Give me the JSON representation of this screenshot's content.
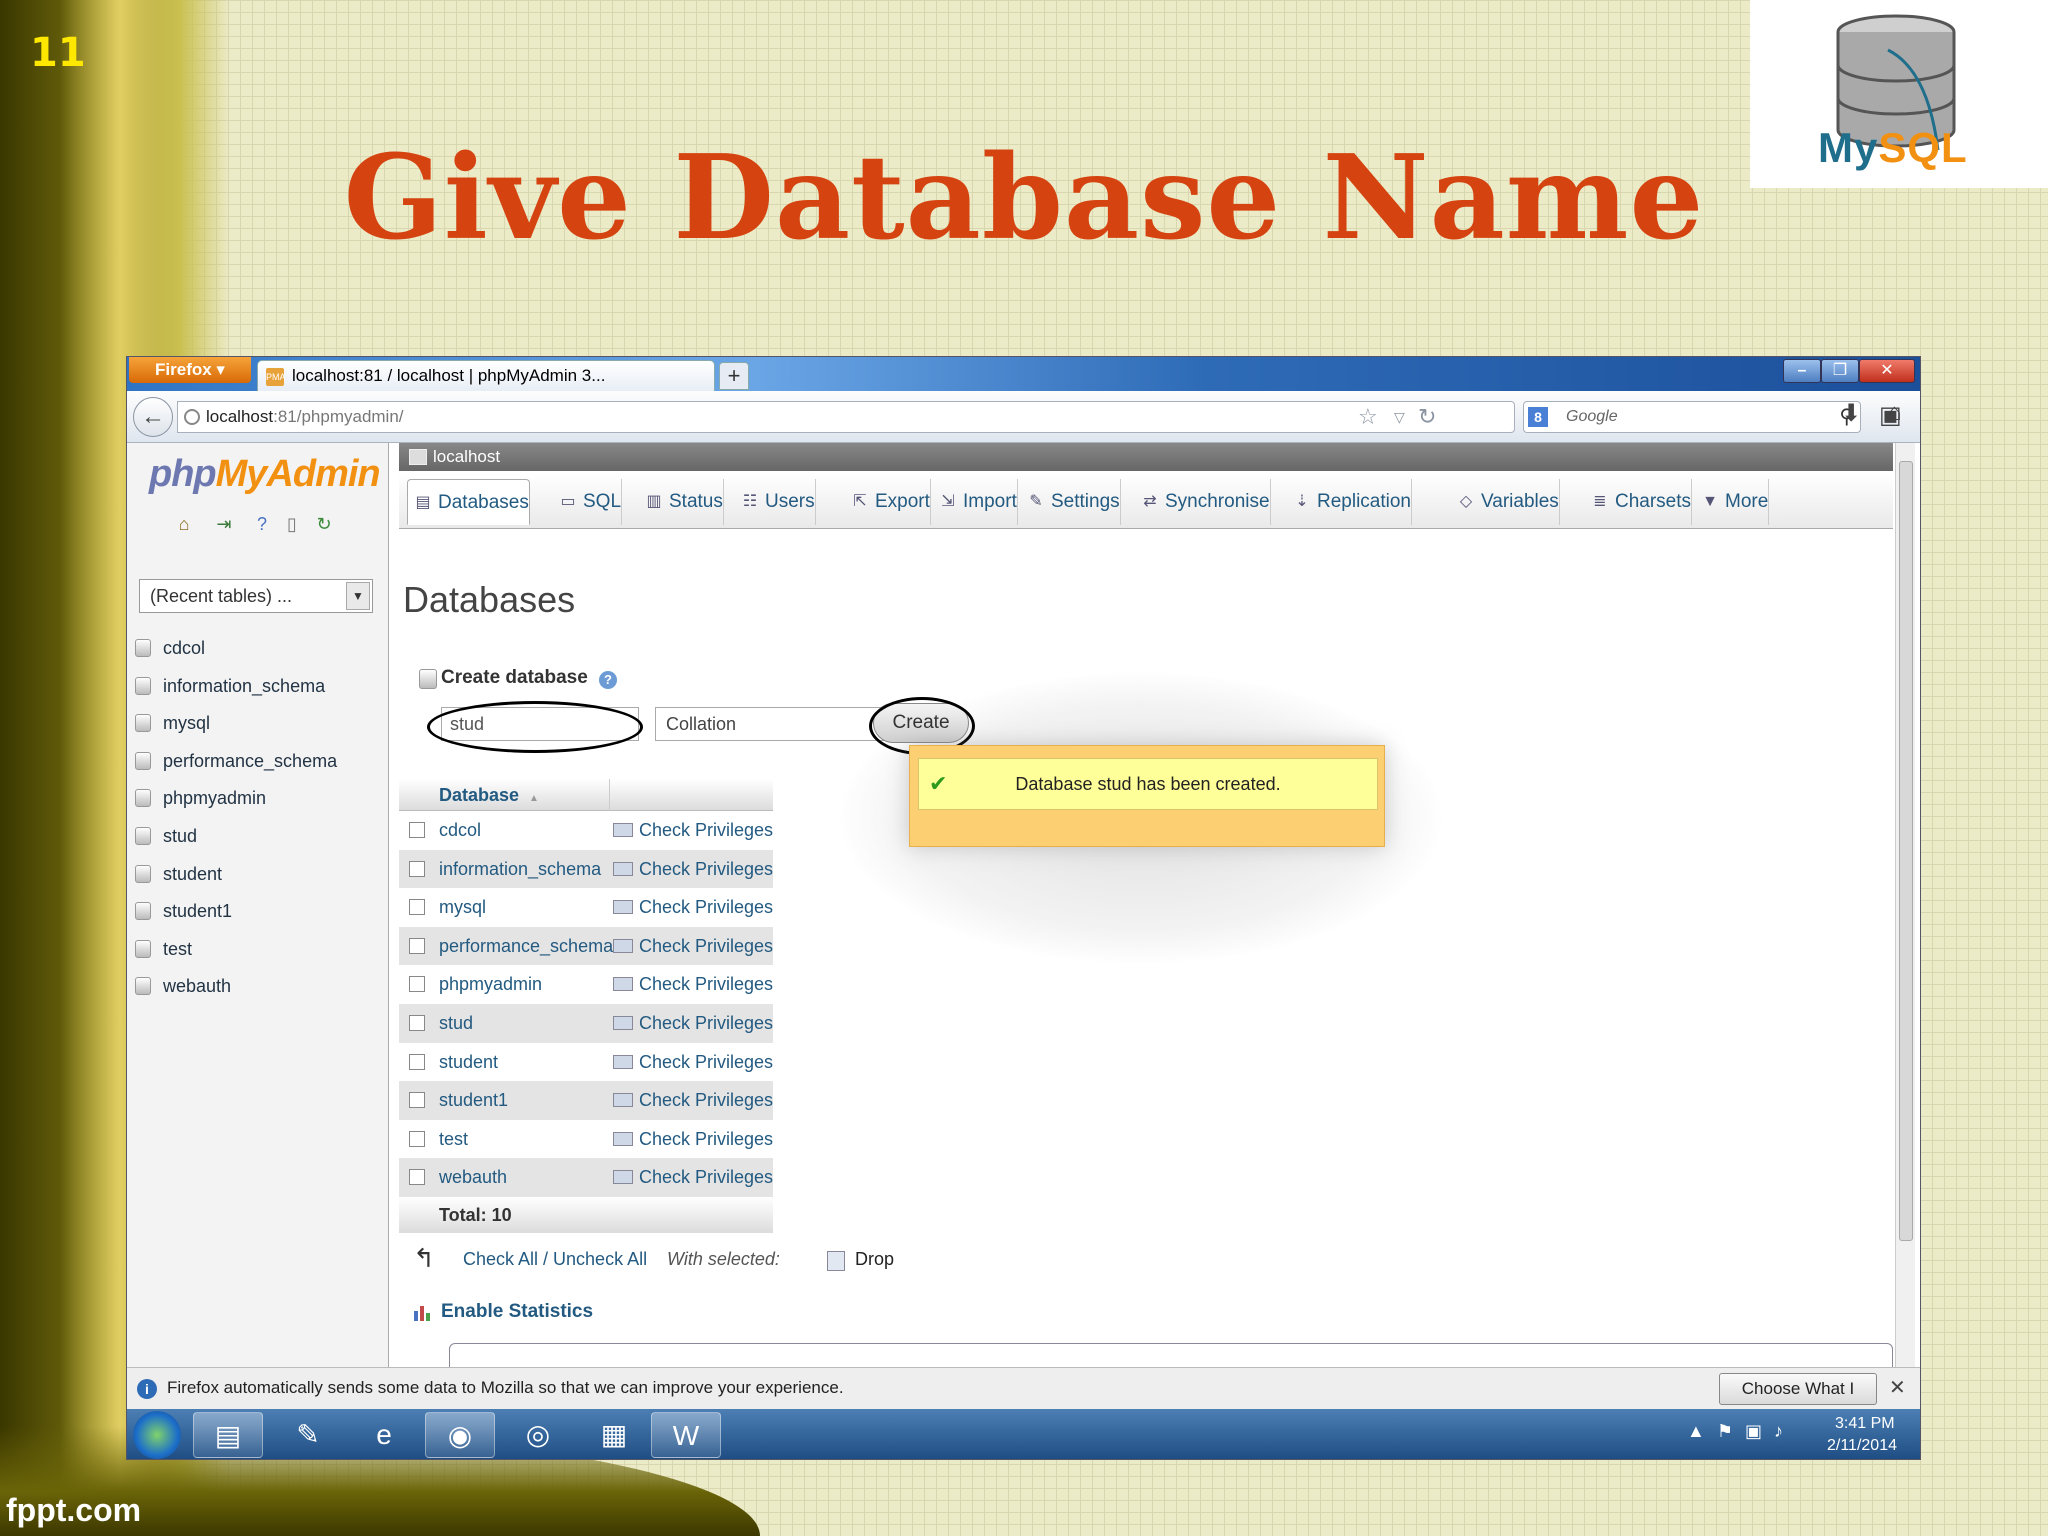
{
  "slide": {
    "number": "11",
    "title": "Give Database Name",
    "footer": "fppt.com",
    "logo_text_my": "My",
    "logo_text_sql": "SQL"
  },
  "browser": {
    "menu_button": "Firefox",
    "tab_title": "localhost:81 / localhost | phpMyAdmin 3...",
    "tab_favicon": "PMA",
    "new_tab": "+",
    "url_host": "localhost",
    "url_rest": ":81/phpmyadmin/",
    "search_placeholder": "Google",
    "notification": "Firefox automatically sends some data to Mozilla so that we can improve your experience.",
    "notification_button": "Choose What I Share"
  },
  "pma": {
    "logo_php": "php",
    "logo_myadmin": "MyAdmin",
    "recent_tables": "(Recent tables) ...",
    "server_label": "localhost",
    "tabs": [
      {
        "label": "Databases",
        "icon": "database-icon"
      },
      {
        "label": "SQL",
        "icon": "sql-icon"
      },
      {
        "label": "Status",
        "icon": "status-icon"
      },
      {
        "label": "Users",
        "icon": "users-icon"
      },
      {
        "label": "Export",
        "icon": "export-icon"
      },
      {
        "label": "Import",
        "icon": "import-icon"
      },
      {
        "label": "Settings",
        "icon": "settings-icon"
      },
      {
        "label": "Synchronise",
        "icon": "synchronise-icon"
      },
      {
        "label": "Replication",
        "icon": "replication-icon"
      },
      {
        "label": "Variables",
        "icon": "variables-icon"
      },
      {
        "label": "Charsets",
        "icon": "charsets-icon"
      },
      {
        "label": "More",
        "icon": "more-icon"
      }
    ],
    "nav_databases": [
      "cdcol",
      "information_schema",
      "mysql",
      "performance_schema",
      "phpmyadmin",
      "stud",
      "student",
      "student1",
      "test",
      "webauth"
    ],
    "heading": "Databases",
    "create_label": "Create database",
    "dbname_value": "stud",
    "collation_placeholder": "Collation",
    "create_button": "Create",
    "notice": "Database stud has been created.",
    "table_header": "Database",
    "privileges_link": "Check Privileges",
    "total": "Total: 10",
    "check_all": "Check All / Uncheck All",
    "with_selected": "With selected:",
    "drop": "Drop",
    "enable_statistics": "Enable Statistics"
  },
  "taskbar": {
    "time": "3:41 PM",
    "date": "2/11/2014"
  },
  "colors": {
    "title": "#d54410",
    "slide_number": "#ffe800",
    "pma_link": "#235a81",
    "notice_bg": "#ffff99"
  }
}
